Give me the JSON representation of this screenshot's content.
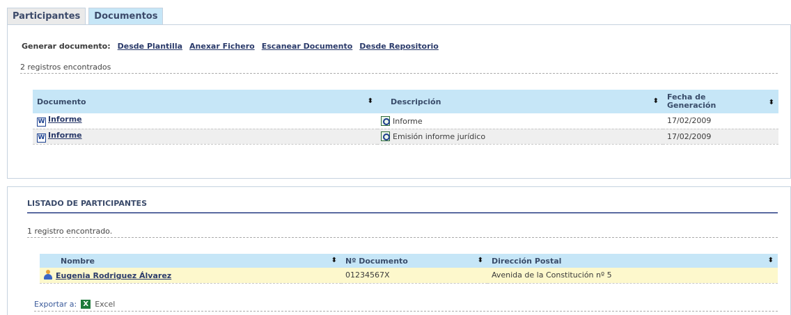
{
  "tabs": [
    {
      "label": "Participantes",
      "active": false
    },
    {
      "label": "Documentos",
      "active": true
    }
  ],
  "documents": {
    "generate_label": "Generar documento:",
    "actions": [
      "Desde Plantilla",
      "Anexar Fichero",
      "Escanear Documento",
      "Desde Repositorio"
    ],
    "count_text": "2 registros encontrados",
    "columns": {
      "documento": "Documento",
      "descripcion": "Descripción",
      "fecha_line1": "Fecha de",
      "fecha_line2": "Generación"
    },
    "rows": [
      {
        "documento": "Informe",
        "descripcion": "Informe",
        "fecha": "17/02/2009",
        "doc_icon": "word-icon",
        "desc_icon": "document-search-icon"
      },
      {
        "documento": "Informe",
        "descripcion": "Emisión informe jurídico",
        "fecha": "17/02/2009",
        "doc_icon": "word-icon",
        "desc_icon": "document-search-icon"
      }
    ]
  },
  "participants": {
    "title": "LISTADO DE PARTICIPANTES",
    "count_text": "1 registro encontrado.",
    "columns": {
      "nombre": "Nombre",
      "documento": "Nº Documento",
      "direccion": "Dirección Postal"
    },
    "rows": [
      {
        "nombre": "Eugenia Rodriguez Álvarez",
        "documento": "01234567X",
        "direccion": "Avenida de la Constitución nº 5",
        "icon": "person-icon"
      }
    ],
    "export_label": "Exportar a:",
    "export_option": "Excel"
  },
  "colors": {
    "header_bg": "#c6e6f7",
    "highlight_row": "#fdf8cc",
    "link": "#2a3a6a"
  }
}
